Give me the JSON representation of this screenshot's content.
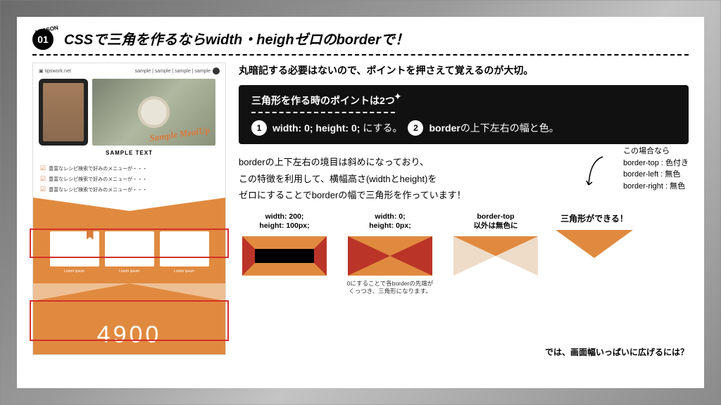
{
  "header": {
    "lesson_tag": "LESSON",
    "lesson_num": "01",
    "title": "CSSで三角を作るならwidth・heighゼロのborderで！"
  },
  "mockup": {
    "brand": "tipswork.net",
    "nav": "sample | sample | sample | sample",
    "sample_text": "SAMPLE TEXT",
    "check_item": "豊富なレシピ検索で好みのメニューが・・・",
    "card_label": "Lorem ipsum",
    "big_number": "4900"
  },
  "right": {
    "intro": "丸暗記する必要はないので、ポイントを押さえて覚えるのが大切。",
    "blackbox": {
      "title": "三角形を作る時のポイントは2つ",
      "p1_pre": "width: 0; height: 0;",
      "p1_post": " にする。",
      "p2_pre": "border",
      "p2_post": "の上下左右の幅と色。"
    },
    "explain_l1": "borderの上下左右の境目は斜めになっており、",
    "explain_l2": "この特徴を利用して、横幅高さ(widthとheight)を",
    "explain_l3": "ゼロにすることでborderの幅で三角形を作っています！",
    "annotation": {
      "l1": "この場合なら",
      "l2": "border-top : 色付き",
      "l3": "border-left : 無色",
      "l4": "border-right : 無色"
    },
    "steps": {
      "s1_l1": "width: 200;",
      "s1_l2": "height: 100px;",
      "s2_l1": "width: 0;",
      "s2_l2": "height: 0px;",
      "s2_note": "0にすることで各borderの先端がくっつき、三角形になります。",
      "s3_l1": "border-top",
      "s3_l2": "以外は無色に",
      "result_label": "三角形ができる！"
    },
    "footer_q": "では、画面幅いっぱいに広げるには？"
  }
}
